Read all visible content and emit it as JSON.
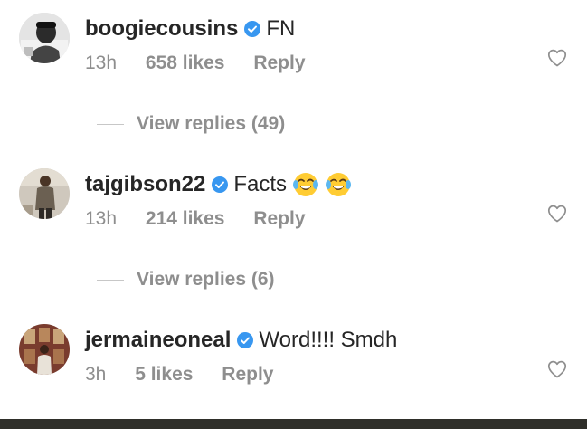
{
  "comments": [
    {
      "username": "boogiecousins",
      "text": "FN",
      "emoji_count": 0,
      "time": "13h",
      "likes": "658 likes",
      "reply": "Reply",
      "verified": true,
      "view_replies": "View replies (49)"
    },
    {
      "username": "tajgibson22",
      "text": "Facts",
      "emoji_count": 2,
      "emoji": "face-with-tears-of-joy",
      "time": "13h",
      "likes": "214 likes",
      "reply": "Reply",
      "verified": true,
      "view_replies": "View replies (6)"
    },
    {
      "username": "jermaineoneal",
      "text": "Word!!!! Smdh",
      "emoji_count": 0,
      "time": "3h",
      "likes": "5 likes",
      "reply": "Reply",
      "verified": true
    }
  ],
  "colors": {
    "text": "#262626",
    "muted": "#8e8e8e",
    "verified": "#3897f0",
    "divider": "#c7c7c7"
  },
  "icons": {
    "like": "heart-outline-icon",
    "verified": "verified-badge-icon"
  }
}
